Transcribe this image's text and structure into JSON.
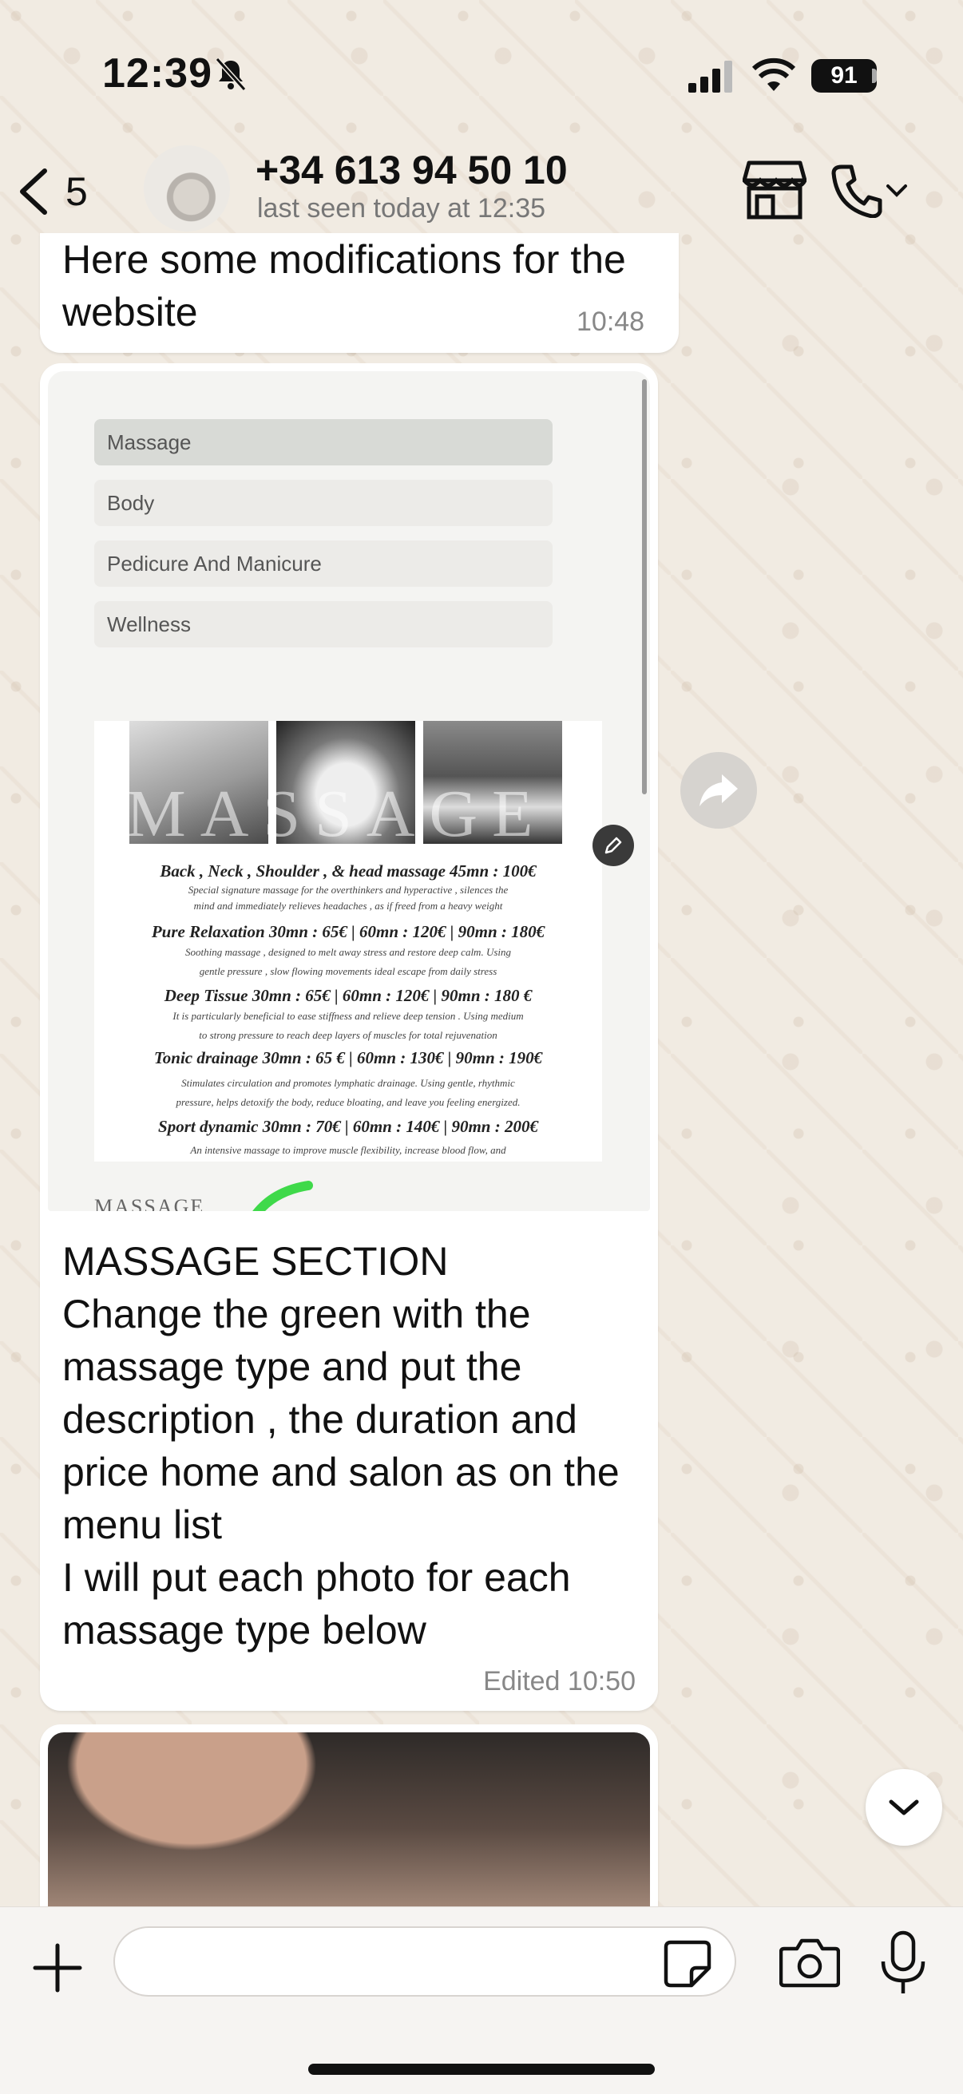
{
  "status_bar": {
    "time": "12:39",
    "battery": "91"
  },
  "header": {
    "back_count": "5",
    "contact_name": "+34 613 94 50 10",
    "contact_status": "last seen today at 12:35"
  },
  "messages": [
    {
      "text": "Here some modifications for the website",
      "time": "10:48"
    },
    {
      "image": {
        "menu": [
          "Massage",
          "Body",
          "Pedicure And Manicure",
          "Wellness"
        ],
        "poster_title": "MASSAGE",
        "poster_lines": [
          "Back , Neck , Shoulder , & head massage  45mn : 100€",
          "Special signature massage for the overthinkers and hyperactive , silences the",
          "mind and immediately relieves headaches , as if freed from a heavy weight",
          "Pure Relaxation  30mn : 65€ | 60mn : 120€ | 90mn : 180€",
          "Soothing massage , designed to melt away stress and restore deep calm. Using",
          "gentle pressure , slow flowing movements ideal escape from daily stress",
          "Deep Tissue  30mn : 65€ | 60mn : 120€ | 90mn : 180 €",
          "It is particularly beneficial to ease stiffness and  relieve  deep  tension . Using medium",
          "to strong pressure to reach deep layers of muscles for total rejuvenation",
          "Tonic drainage  30mn : 65 € | 60mn : 130€ | 90mn : 190€",
          "Stimulates circulation and promotes lymphatic drainage. Using gentle, rhythmic",
          "pressure, helps detoxify the body, reduce bloating, and leave you feeling energized.",
          "Sport dynamic  30mn : 70€ | 60mn : 140€ | 90mn : 200€",
          "An intensive massage to improve muscle flexibility, increase blood flow, and"
        ],
        "section_label": "MASSAGE"
      },
      "lines": [
        "MASSAGE SECTION",
        "Change the green with the",
        "massage type and put the",
        "description , the duration and",
        "price home and salon as on the",
        "menu list",
        "I will put each photo for each",
        "massage type below"
      ],
      "time": "Edited 10:50"
    }
  ],
  "composer": {
    "placeholder": ""
  },
  "colors": {
    "accent_green": "#3fd94a",
    "bubble": "#ffffff",
    "wallpaper": "#f1ebe2"
  },
  "icons": [
    "bell-slash-icon",
    "signal-icon",
    "wifi-icon",
    "back-chevron-icon",
    "shop-icon",
    "phone-icon",
    "chevron-down-icon",
    "forward-icon",
    "edit-icon",
    "plus-icon",
    "sticker-icon",
    "camera-icon",
    "microphone-icon"
  ]
}
